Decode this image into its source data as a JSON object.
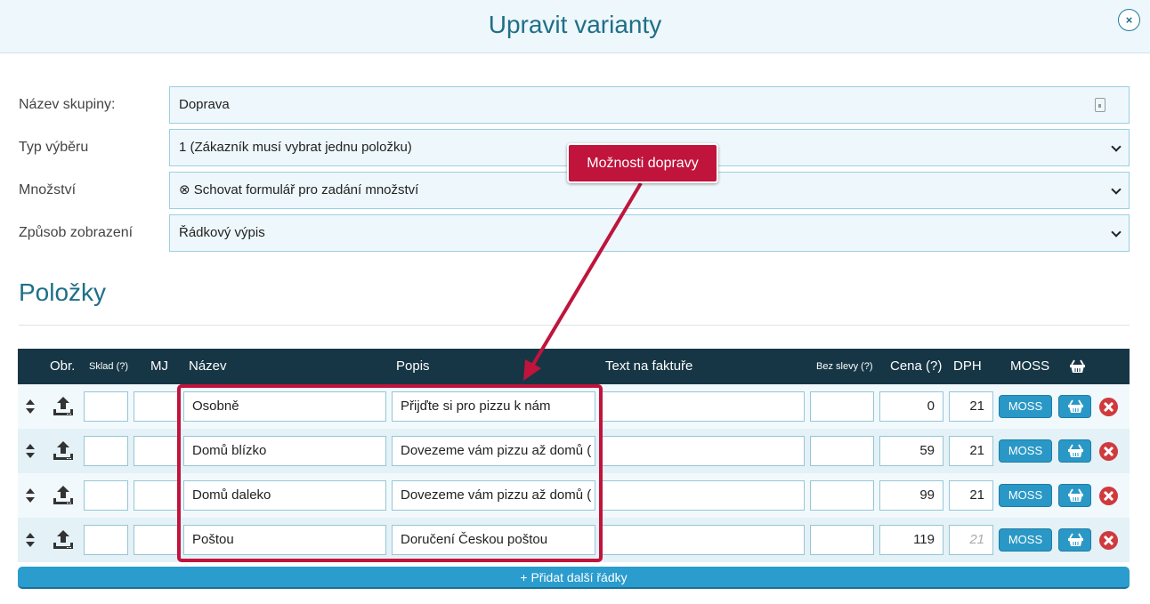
{
  "modal": {
    "title": "Upravit varianty",
    "close_label": "×"
  },
  "form": {
    "group_name_label": "Název skupiny:",
    "group_name_value": "Doprava",
    "selection_type_label": "Typ výběru",
    "selection_type_value": "1 (Zákazník musí vybrat jednu položku)",
    "quantity_label": "Množství",
    "quantity_value": "⊗ Schovat formulář pro zadání množství",
    "display_mode_label": "Způsob zobrazení",
    "display_mode_value": "Řádkový výpis"
  },
  "items_section": {
    "title": "Položky"
  },
  "table": {
    "headers": {
      "image": "Obr.",
      "stock": "Sklad (?)",
      "unit": "MJ",
      "name": "Název",
      "description": "Popis",
      "invoice_text": "Text na faktuře",
      "no_discount": "Bez slevy (?)",
      "price": "Cena (?)",
      "vat": "DPH",
      "moss": "MOSS"
    },
    "rows": [
      {
        "name": "Osobně",
        "description": "Přijďte si pro pizzu k nám",
        "price": "0",
        "vat": "21",
        "moss": "MOSS",
        "vat_muted": false
      },
      {
        "name": "Domů blízko",
        "description": "Dovezeme vám pizzu až domů (",
        "price": "59",
        "vat": "21",
        "moss": "MOSS",
        "vat_muted": false
      },
      {
        "name": "Domů daleko",
        "description": "Dovezeme vám pizzu až domů (",
        "price": "99",
        "vat": "21",
        "moss": "MOSS",
        "vat_muted": false
      },
      {
        "name": "Poštou",
        "description": "Doručení Českou poštou",
        "price": "119",
        "vat": "21",
        "moss": "MOSS",
        "vat_muted": true
      }
    ],
    "add_rows_label": "+ Přidat další řádky"
  },
  "annotation": {
    "callout_label": "Možnosti dopravy",
    "color": "#c0143c"
  },
  "colors": {
    "accent": "#1f6f87",
    "table_header": "#163645",
    "button_blue": "#2a98c6",
    "delete_red": "#d03a3d"
  }
}
